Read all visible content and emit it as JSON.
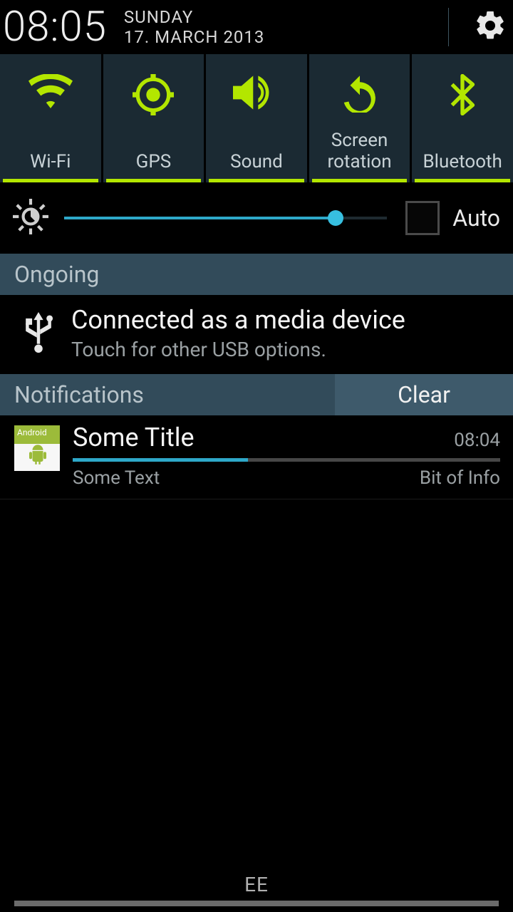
{
  "header": {
    "clock": "08:05",
    "day": "SUNDAY",
    "date": "17. MARCH 2013"
  },
  "toggles": [
    {
      "id": "wifi",
      "label": "Wi-Fi",
      "icon": "wifi-icon"
    },
    {
      "id": "gps",
      "label": "GPS",
      "icon": "gps-icon"
    },
    {
      "id": "sound",
      "label": "Sound",
      "icon": "sound-icon"
    },
    {
      "id": "rotate",
      "label": "Screen\nrotation",
      "icon": "rotate-icon"
    },
    {
      "id": "bt",
      "label": "Bluetooth",
      "icon": "bluetooth-icon"
    }
  ],
  "brightness": {
    "percent": 84,
    "auto_checked": false,
    "auto_label": "Auto"
  },
  "ongoing": {
    "header": "Ongoing",
    "items": [
      {
        "title": "Connected as a media device",
        "subtitle": "Touch for other USB options.",
        "icon": "usb-icon"
      }
    ]
  },
  "notifications": {
    "header": "Notifications",
    "clear_label": "Clear",
    "items": [
      {
        "app_badge": "Android",
        "title": "Some Title",
        "time": "08:04",
        "progress_percent": 41,
        "text": "Some Text",
        "info": "Bit of Info"
      }
    ]
  },
  "footer": {
    "carrier": "EE"
  },
  "colors": {
    "accent": "#b3e600",
    "slider": "#2ea8c9",
    "panel": "#1b2a33",
    "section": "#324b5a"
  }
}
